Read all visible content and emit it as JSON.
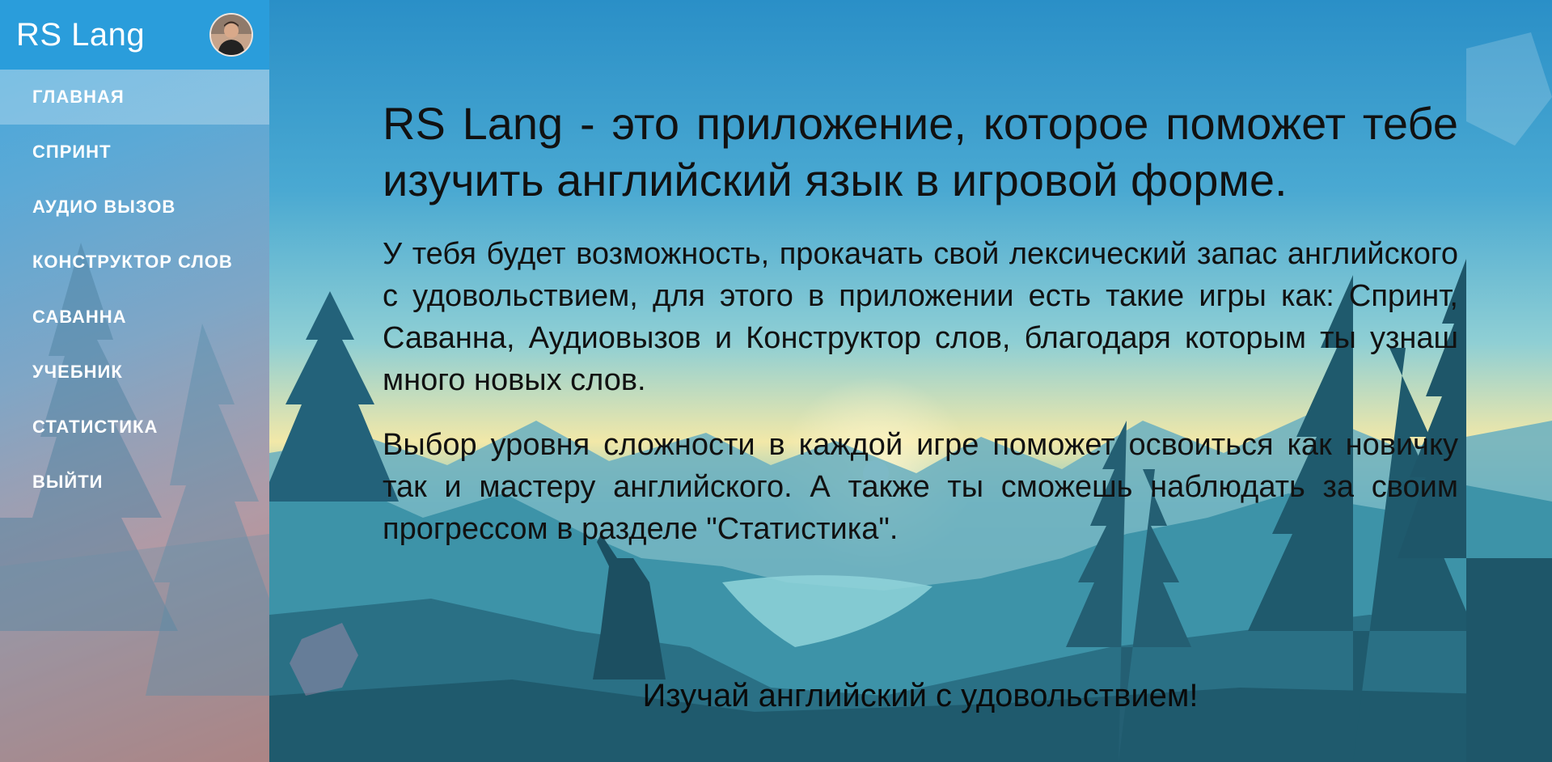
{
  "app": {
    "title": "RS Lang"
  },
  "sidebar": {
    "items": [
      {
        "label": "ГЛАВНАЯ",
        "active": true
      },
      {
        "label": "СПРИНТ"
      },
      {
        "label": "АУДИО ВЫЗОВ"
      },
      {
        "label": "КОНСТРУКТОР СЛОВ"
      },
      {
        "label": "САВАННА"
      },
      {
        "label": "УЧЕБНИК"
      },
      {
        "label": "СТАТИСТИКА"
      },
      {
        "label": "ВЫЙТИ"
      }
    ]
  },
  "main": {
    "headline": "RS Lang - это приложение, которое поможет тебе изучить английский язык в игровой форме.",
    "paragraphs": [
      "У тебя будет возможность, прокачать свой лексический запас английского с удовольствием, для этого в приложении есть такие игры как: Спринт, Саванна, Аудиовызов и Конструктор слов, благодаря которым ты узнаш много новых слов.",
      "Выбор уровня сложности в каждой игре поможет освоиться как новичку так и мастеру английского. А также ты сможешь наблюдать за своим прогрессом в разделе \"Статистика\"."
    ],
    "tagline": "Изучай английский с удовольствием!"
  },
  "icons": {
    "avatar": "user-avatar-icon"
  },
  "colors": {
    "header": "#2a9ddb",
    "nav_text": "#ffffff",
    "sky_top": "#2a8fc7",
    "sun": "#fff6cc"
  }
}
